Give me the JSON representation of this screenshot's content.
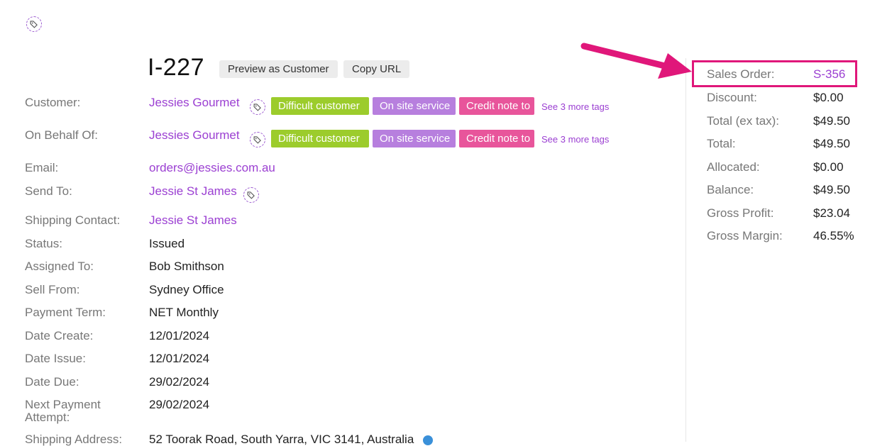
{
  "invoice": {
    "number": "I-227",
    "preview_label": "Preview as Customer",
    "copy_url_label": "Copy URL"
  },
  "fields": {
    "customer": {
      "label": "Customer:",
      "value": "Jessies Gourmet"
    },
    "on_behalf_of": {
      "label": "On Behalf Of:",
      "value": "Jessies Gourmet"
    },
    "email": {
      "label": "Email:",
      "value": "orders@jessies.com.au"
    },
    "send_to": {
      "label": "Send To:",
      "value": "Jessie St James"
    },
    "shipping_contact": {
      "label": "Shipping Contact:",
      "value": "Jessie St James"
    },
    "status": {
      "label": "Status:",
      "value": "Issued"
    },
    "assigned_to": {
      "label": "Assigned To:",
      "value": "Bob Smithson"
    },
    "sell_from": {
      "label": "Sell From:",
      "value": "Sydney Office"
    },
    "payment_term": {
      "label": "Payment Term:",
      "value": "NET Monthly"
    },
    "date_create": {
      "label": "Date Create:",
      "value": "12/01/2024"
    },
    "date_issue": {
      "label": "Date Issue:",
      "value": "12/01/2024"
    },
    "date_due": {
      "label": "Date Due:",
      "value": "29/02/2024"
    },
    "next_payment_attempt": {
      "label_line1": "Next Payment",
      "label_line2": "Attempt:",
      "value": "29/02/2024"
    },
    "shipping_address": {
      "label": "Shipping Address:",
      "value": "52 Toorak Road, South Yarra, VIC 3141, Australia"
    }
  },
  "tags": {
    "items": [
      {
        "label": "Difficult customer",
        "color": "#9ccc2c"
      },
      {
        "label": "On site service",
        "color": "#b77fde"
      },
      {
        "label": "Credit note to",
        "color": "#e8559b"
      }
    ],
    "more_label": "See 3 more tags"
  },
  "summary": {
    "sales_order": {
      "label": "Sales Order:",
      "value": "S-356"
    },
    "discount": {
      "label": "Discount:",
      "value": "$0.00"
    },
    "total_ex_tax": {
      "label": "Total (ex tax):",
      "value": "$49.50"
    },
    "total": {
      "label": "Total:",
      "value": "$49.50"
    },
    "allocated": {
      "label": "Allocated:",
      "value": "$0.00"
    },
    "balance": {
      "label": "Balance:",
      "value": "$49.50"
    },
    "gross_profit": {
      "label": "Gross Profit:",
      "value": "$23.04"
    },
    "gross_margin": {
      "label": "Gross Margin:",
      "value": "46.55%"
    }
  },
  "colors": {
    "link": "#9b3fd2",
    "highlight": "#e0177a",
    "arrow": "#e0177a"
  }
}
